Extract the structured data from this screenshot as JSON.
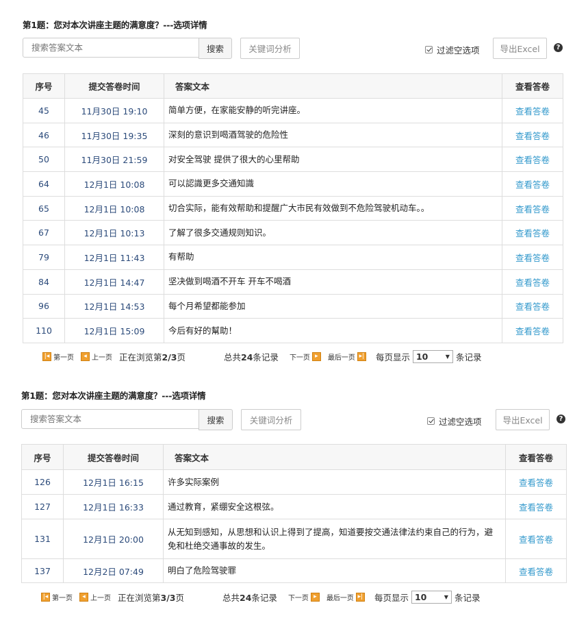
{
  "sections": [
    {
      "title": "第1题：您对本次讲座主题的满意度？---选项详情",
      "search_placeholder": "搜索答案文本",
      "search_button": "搜索",
      "keyword_button": "关键词分析",
      "filter_label": "过滤空选项",
      "filter_checked": true,
      "export_button": "导出Excel",
      "help": "?",
      "headers": [
        "序号",
        "提交答卷时间",
        "答案文本",
        "查看答卷"
      ],
      "rows": [
        {
          "id": "45",
          "time": "11月30日 19:10",
          "text": "简单方便，在家能安静的听完讲座。",
          "view": "查看答卷"
        },
        {
          "id": "46",
          "time": "11月30日 19:35",
          "text": "深刻的意识到喝酒驾驶的危险性",
          "view": "查看答卷"
        },
        {
          "id": "50",
          "time": "11月30日 21:59",
          "text": "对安全驾驶 提供了很大的心里帮助",
          "view": "查看答卷"
        },
        {
          "id": "64",
          "time": "12月1日 10:08",
          "text": "可以認識更多交通知識",
          "view": "查看答卷"
        },
        {
          "id": "65",
          "time": "12月1日 10:08",
          "text": "切合实际，能有效帮助和提醒广大市民有效做到不危险驾驶机动车。。",
          "view": "查看答卷"
        },
        {
          "id": "67",
          "time": "12月1日 10:13",
          "text": "了解了很多交通规则知识。",
          "view": "查看答卷"
        },
        {
          "id": "79",
          "time": "12月1日 11:43",
          "text": "有帮助",
          "view": "查看答卷"
        },
        {
          "id": "84",
          "time": "12月1日 14:47",
          "text": "坚决做到喝酒不开车 开车不喝酒",
          "view": "查看答卷"
        },
        {
          "id": "96",
          "time": "12月1日 14:53",
          "text": "每个月希望都能参加",
          "view": "查看答卷"
        },
        {
          "id": "110",
          "time": "12月1日 15:09",
          "text": "今后有好的幫助！",
          "view": "查看答卷"
        }
      ],
      "pager": {
        "first": "第一页",
        "prev": "上一页",
        "browsing_prefix": "正在浏览第",
        "browsing_page": "2/3",
        "browsing_suffix": "页",
        "total_prefix": "总共",
        "total_count": "24",
        "total_suffix": "条记录",
        "next": "下一页",
        "last": "最后一页",
        "per_page_label": "每页显示",
        "per_page_value": "10",
        "records": "条记录"
      }
    },
    {
      "title": "第1题：您对本次讲座主题的满意度？---选项详情",
      "search_placeholder": "搜索答案文本",
      "search_button": "搜索",
      "keyword_button": "关键词分析",
      "filter_label": "过滤空选项",
      "filter_checked": true,
      "export_button": "导出Excel",
      "help": "?",
      "headers": [
        "序号",
        "提交答卷时间",
        "答案文本",
        "查看答卷"
      ],
      "rows": [
        {
          "id": "126",
          "time": "12月1日 16:15",
          "text": "许多实际案例",
          "view": "查看答卷"
        },
        {
          "id": "127",
          "time": "12月1日 16:33",
          "text": "通过教育，紧绷安全这根弦。",
          "view": "查看答卷"
        },
        {
          "id": "131",
          "time": "12月1日 20:00",
          "text": "从无知到感知，从思想和认识上得到了提高，知道要按交通法律法约束自己的行为，避免和杜绝交通事故的发生。",
          "view": "查看答卷"
        },
        {
          "id": "137",
          "time": "12月2日 07:49",
          "text": "明白了危险驾驶罪",
          "view": "查看答卷"
        }
      ],
      "pager": {
        "first": "第一页",
        "prev": "上一页",
        "browsing_prefix": "正在浏览第",
        "browsing_page": "3/3",
        "browsing_suffix": "页",
        "total_prefix": "总共",
        "total_count": "24",
        "total_suffix": "条记录",
        "next": "下一页",
        "last": "最后一页",
        "per_page_label": "每页显示",
        "per_page_value": "10",
        "records": "条记录"
      }
    }
  ]
}
